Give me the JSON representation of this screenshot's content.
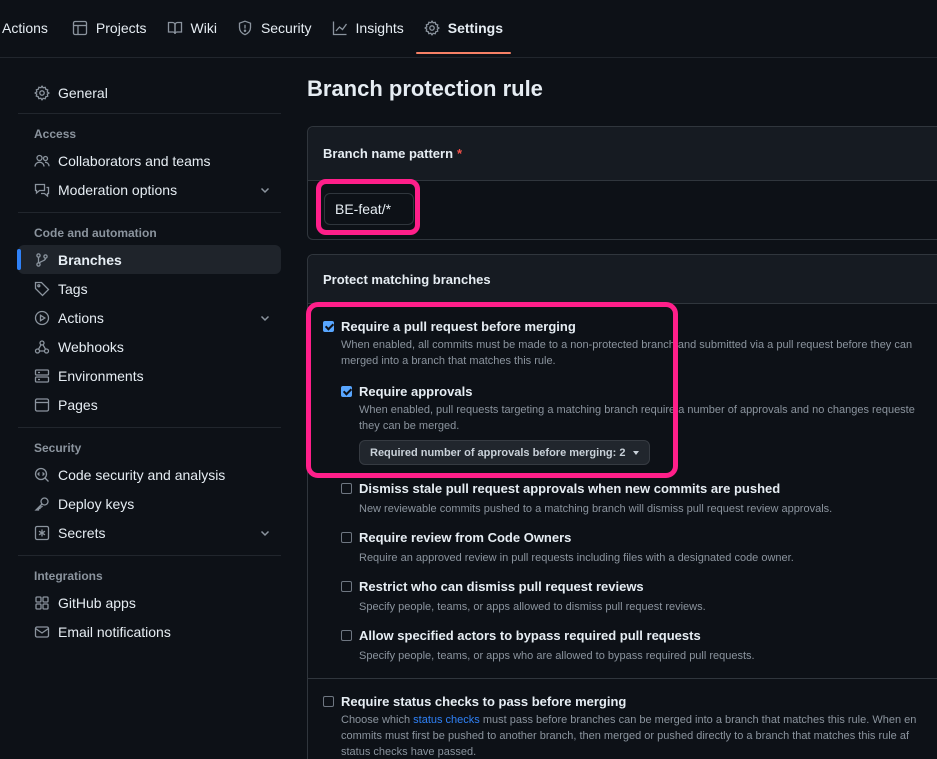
{
  "topnav": {
    "tabs": [
      {
        "label": "Actions",
        "icon": "play-icon"
      },
      {
        "label": "Projects",
        "icon": "table-icon"
      },
      {
        "label": "Wiki",
        "icon": "book-icon"
      },
      {
        "label": "Security",
        "icon": "shield-icon"
      },
      {
        "label": "Insights",
        "icon": "graph-icon"
      },
      {
        "label": "Settings",
        "icon": "gear-icon",
        "active": true
      }
    ]
  },
  "sidebar": {
    "general": "General",
    "access_heading": "Access",
    "collaborators": "Collaborators and teams",
    "moderation": "Moderation options",
    "code_heading": "Code and automation",
    "branches": "Branches",
    "tags": "Tags",
    "actions": "Actions",
    "webhooks": "Webhooks",
    "environments": "Environments",
    "pages": "Pages",
    "security_heading": "Security",
    "code_security": "Code security and analysis",
    "deploy_keys": "Deploy keys",
    "secrets": "Secrets",
    "integrations_heading": "Integrations",
    "github_apps": "GitHub apps",
    "email_notifications": "Email notifications"
  },
  "main": {
    "title": "Branch protection rule",
    "pattern_label": "Branch name pattern",
    "required_mark": "*",
    "pattern_value": "BE-feat/*",
    "protect_heading": "Protect matching branches",
    "options": {
      "pr": {
        "title": "Require a pull request before merging",
        "desc1": "When enabled, all commits must be made to a non-protected branch and submitted via a pull request before they can",
        "desc2": "merged into a branch that matches this rule.",
        "checked": true
      },
      "approvals": {
        "title": "Require approvals",
        "desc1": "When enabled, pull requests targeting a matching branch require a number of approvals and no changes requeste",
        "desc2": "they can be merged.",
        "select_label": "Required number of approvals before merging: 2",
        "checked": true
      },
      "dismiss": {
        "title": "Dismiss stale pull request approvals when new commits are pushed",
        "desc": "New reviewable commits pushed to a matching branch will dismiss pull request review approvals.",
        "checked": false
      },
      "codeowners": {
        "title": "Require review from Code Owners",
        "desc": "Require an approved review in pull requests including files with a designated code owner.",
        "checked": false
      },
      "restrict": {
        "title": "Restrict who can dismiss pull request reviews",
        "desc": "Specify people, teams, or apps allowed to dismiss pull request reviews.",
        "checked": false
      },
      "bypass": {
        "title": "Allow specified actors to bypass required pull requests",
        "desc": "Specify people, teams, or apps who are allowed to bypass required pull requests.",
        "checked": false
      },
      "status": {
        "title": "Require status checks to pass before merging",
        "desc1_pre": "Choose which ",
        "desc1_link": "status checks",
        "desc1_post": " must pass before branches can be merged into a branch that matches this rule. When en",
        "desc2": "commits must first be pushed to another branch, then merged or pushed directly to a branch that matches this rule af",
        "desc3": "status checks have passed.",
        "checked": false
      }
    }
  },
  "colors": {
    "highlight": "#ff1f8a",
    "accent": "#2f81f7",
    "tab_underline": "#f78166"
  }
}
